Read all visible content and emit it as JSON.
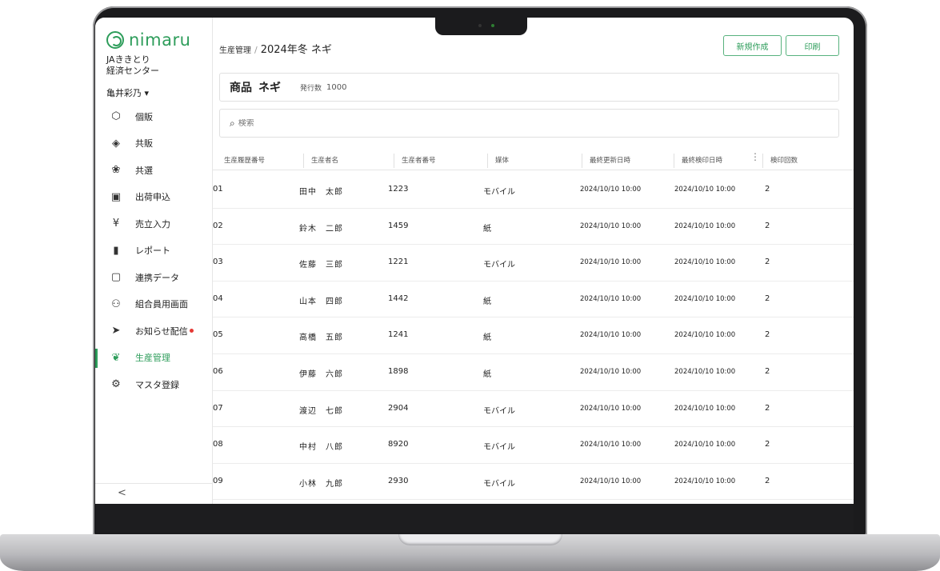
{
  "brand": {
    "name": "nimaru"
  },
  "org": {
    "line1": "JAききとり",
    "line2": "経済センター",
    "user": "亀井彩乃 ▾"
  },
  "nav": [
    {
      "icon": "cube-icon",
      "glyph": "⬡",
      "label": "個販"
    },
    {
      "icon": "cubes-icon",
      "glyph": "◈",
      "label": "共販"
    },
    {
      "icon": "grapes-icon",
      "glyph": "❀",
      "label": "共選"
    },
    {
      "icon": "calendar-icon",
      "glyph": "▣",
      "label": "出荷申込"
    },
    {
      "icon": "yen-icon",
      "glyph": "¥",
      "label": "売立入力"
    },
    {
      "icon": "bar-chart-icon",
      "glyph": "▮",
      "label": "レポート"
    },
    {
      "icon": "document-icon",
      "glyph": "▢",
      "label": "連携データ"
    },
    {
      "icon": "members-icon",
      "glyph": "⚇",
      "label": "組合員用画面"
    },
    {
      "icon": "send-icon",
      "glyph": "➤",
      "label": "お知らせ配信"
    },
    {
      "icon": "sprout-icon",
      "glyph": "❦",
      "label": "生産管理"
    },
    {
      "icon": "settings-icon",
      "glyph": "⚙",
      "label": "マスタ登録"
    }
  ],
  "collapse_label": "<",
  "breadcrumb": {
    "parent": "生産管理",
    "separator": "/",
    "current": "2024年冬 ネギ"
  },
  "actions": {
    "new": "新規作成",
    "print": "印刷"
  },
  "product": {
    "label": "商品",
    "name": "ネギ",
    "issued_label": "発行数",
    "issued_value": "1000"
  },
  "search": {
    "placeholder": "検索"
  },
  "table": {
    "columns": [
      "生産履歴番号",
      "生産者名",
      "生産者番号",
      "媒体",
      "最終更新日時",
      "最終検印日時",
      "検印回数"
    ],
    "rows": [
      [
        "01",
        "田中　太郎",
        "1223",
        "モバイル",
        "2024/10/10 10:00",
        "2024/10/10 10:00",
        "2"
      ],
      [
        "02",
        "鈴木　二郎",
        "1459",
        "紙",
        "2024/10/10 10:00",
        "2024/10/10 10:00",
        "2"
      ],
      [
        "03",
        "佐藤　三郎",
        "1221",
        "モバイル",
        "2024/10/10 10:00",
        "2024/10/10 10:00",
        "2"
      ],
      [
        "04",
        "山本　四郎",
        "1442",
        "紙",
        "2024/10/10 10:00",
        "2024/10/10 10:00",
        "2"
      ],
      [
        "05",
        "高橋　五郎",
        "1241",
        "紙",
        "2024/10/10 10:00",
        "2024/10/10 10:00",
        "2"
      ],
      [
        "06",
        "伊藤　六郎",
        "1898",
        "紙",
        "2024/10/10 10:00",
        "2024/10/10 10:00",
        "2"
      ],
      [
        "07",
        "渡辺　七郎",
        "2904",
        "モバイル",
        "2024/10/10 10:00",
        "2024/10/10 10:00",
        "2"
      ],
      [
        "08",
        "中村　八郎",
        "8920",
        "モバイル",
        "2024/10/10 10:00",
        "2024/10/10 10:00",
        "2"
      ],
      [
        "09",
        "小林　九郎",
        "2930",
        "モバイル",
        "2024/10/10 10:00",
        "2024/10/10 10:00",
        "2"
      ]
    ]
  },
  "colors": {
    "accent": "#2e9d5b",
    "notification": "#e53935"
  }
}
